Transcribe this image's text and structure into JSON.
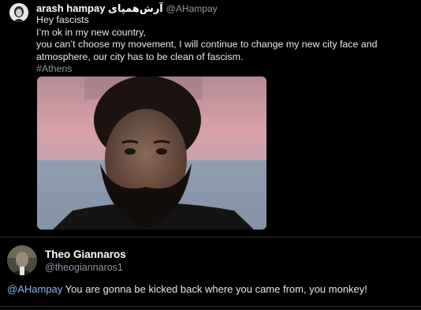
{
  "tweet": {
    "author_name": "arash hampay آرش‌همپای",
    "author_handle": "@AHampay",
    "lines": [
      "Hey fascists",
      "I’m ok in my new country,",
      "you can’t choose my movement, I will continue to change my new city face and",
      "atmosphere, our city has to be clean of fascism."
    ],
    "hashtag": "#Athens"
  },
  "reply": {
    "author_name": "Theo Giannaros",
    "author_handle": "@theogiannaros1",
    "mention": "@AHampay",
    "text": " You are gonna be kicked back where you came from, you monkey!"
  }
}
